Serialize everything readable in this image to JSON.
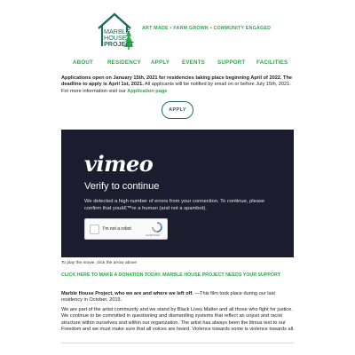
{
  "brand": {
    "logo_text": [
      "MARBLE",
      "HOUSE",
      "PROJECT"
    ],
    "tagline": "ART MADE • FARM GROWN • COMMUNITY ENGAGED",
    "primary_color": "#2aa84a",
    "dark_color": "#1f6e5d"
  },
  "nav": {
    "items": [
      {
        "label": "ABOUT"
      },
      {
        "label": "RESIDENCY"
      },
      {
        "label": "APPLY"
      },
      {
        "label": "EVENTS"
      },
      {
        "label": "SUPPORT"
      },
      {
        "label": "FACILITIES"
      }
    ]
  },
  "intro": {
    "bold_text": "Applications open on January 15th, 2021 for residencies taking place beginning April of 2022. The deadline to apply is April 1st, 2021.",
    "normal_text": " All applicants will be notified by email on or before July 15th, 2021.  For more information visit our ",
    "link_text": "Application page"
  },
  "apply_button": {
    "label": "APPLY"
  },
  "video": {
    "logo": "vimeo",
    "title": "Verify to continue",
    "message": "We detected a high number of errors from your connection. To continue, please confirm that youâ€™re a human (and not a spambot).",
    "captcha_label": "I'm not a robot",
    "captcha_brand": "reCAPTCHA",
    "background_color": "#1b1d2e"
  },
  "caption": "To play the movie, click the arrow above",
  "donate_link": "CLICK HERE TO MAKE A DONATION TODAY.  MARBLE HOUSE PROJECT NEEDS YOUR SUPPORT",
  "para1": {
    "bold_text": "Marble House Project, who we are and where we left off.",
    "normal_text": " —This film took place during our last residency in October, 2019."
  },
  "para2": "We are part of the artist community and we stand by Black Lives Matter and all those who fight for justice. We continue to be committed in questioning and dismantling systems that reflect an unjust and racist structure within ourselves and within our organization. The artist has always been the litmus test to our Freedom and we must make sure that all voices are heard. Violence towards some is violence towards all."
}
